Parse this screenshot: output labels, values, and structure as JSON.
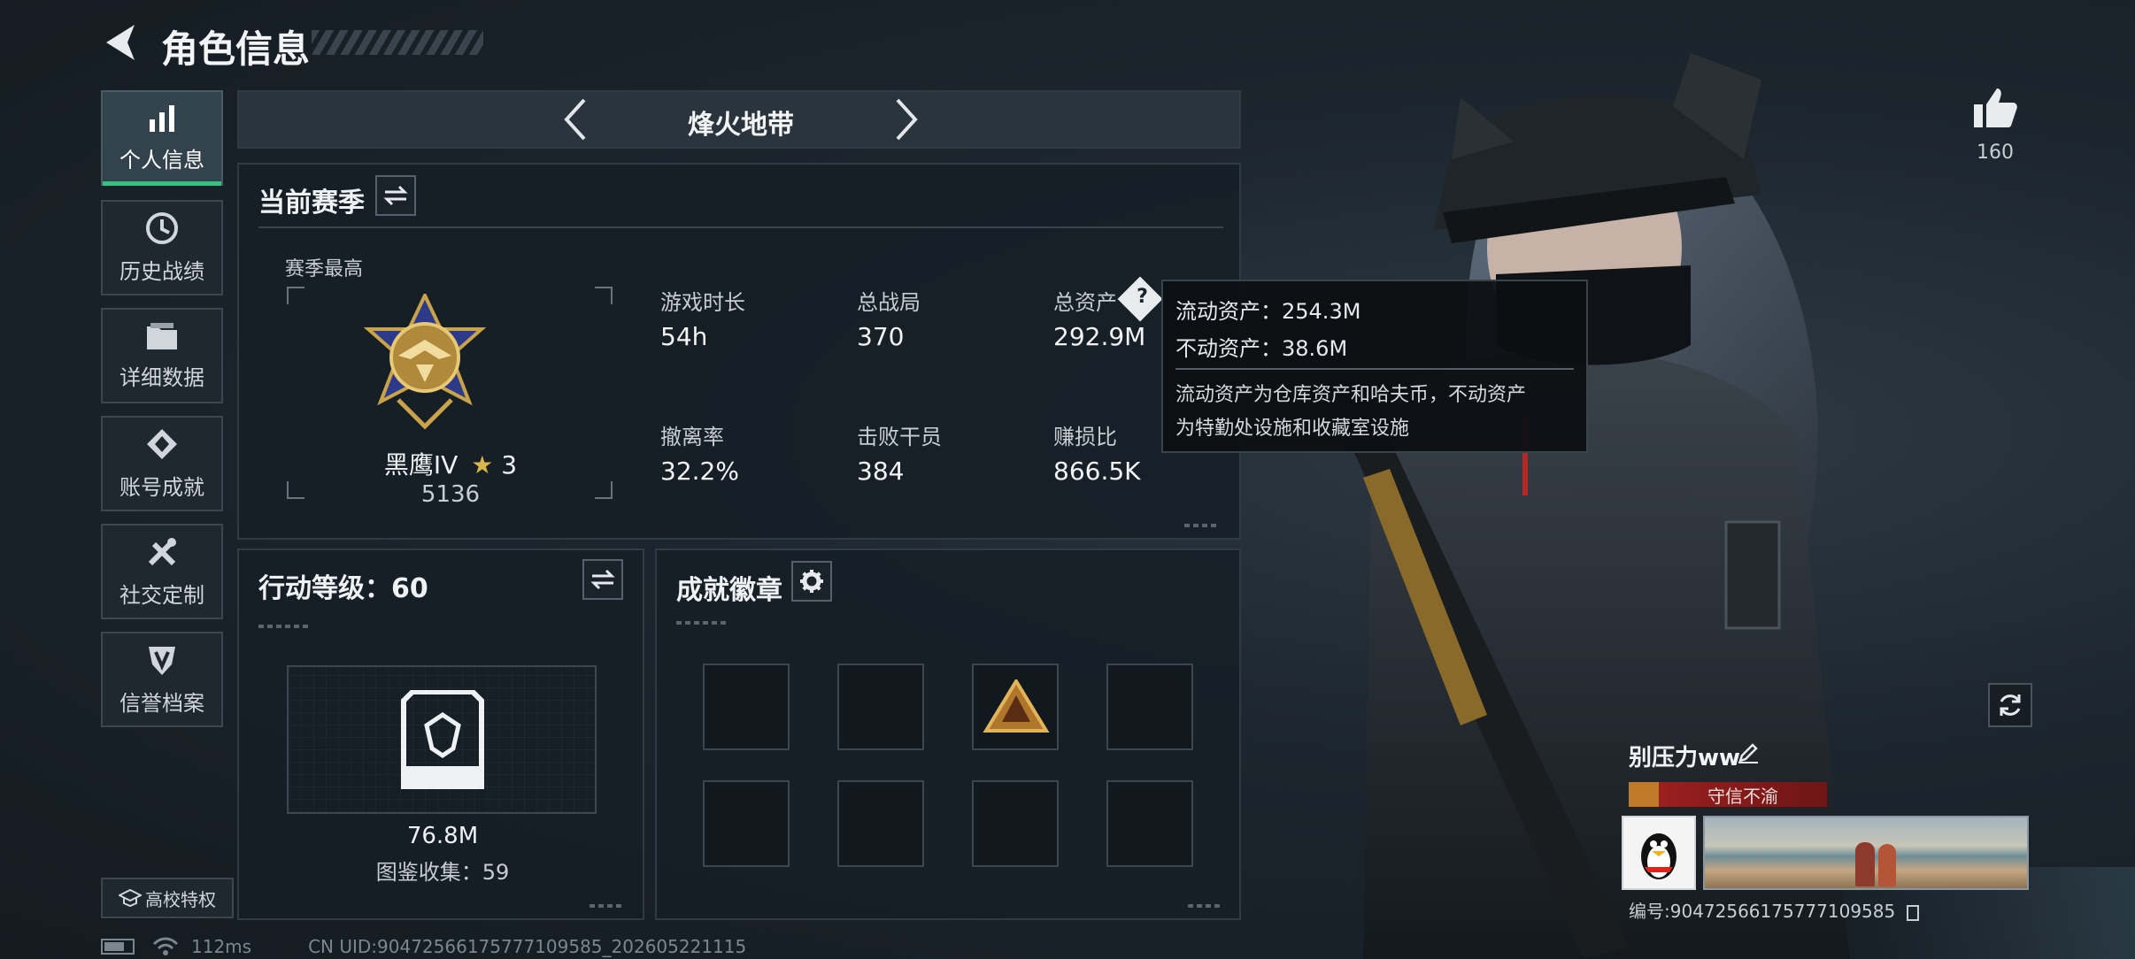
{
  "header": {
    "title": "角色信息"
  },
  "sidebar": {
    "items": [
      {
        "label": "个人信息",
        "icon": "bar-chart-icon",
        "active": true
      },
      {
        "label": "历史战绩",
        "icon": "history-icon"
      },
      {
        "label": "详细数据",
        "icon": "folder-icon"
      },
      {
        "label": "账号成就",
        "icon": "achievement-icon"
      },
      {
        "label": "社交定制",
        "icon": "tools-icon"
      },
      {
        "label": "信誉档案",
        "icon": "shield-icon"
      }
    ],
    "campus_label": "高校特权"
  },
  "mode_selector": {
    "label": "烽火地带"
  },
  "season": {
    "title": "当前赛季",
    "best_label": "赛季最高",
    "rank_name": "黑鹰IV",
    "rank_stars": "3",
    "rank_points": "5136",
    "stats": [
      {
        "label": "游戏时长",
        "value": "54h"
      },
      {
        "label": "总战局",
        "value": "370"
      },
      {
        "label": "总资产",
        "value": "292.9M"
      },
      {
        "label": "撤离率",
        "value": "32.2%"
      },
      {
        "label": "击败干员",
        "value": "384"
      },
      {
        "label": "赚损比",
        "value": "866.5K"
      }
    ]
  },
  "tooltip": {
    "liquid_label": "流动资产：",
    "liquid_value": "254.3M",
    "fixed_label": "不动资产：",
    "fixed_value": "38.6M",
    "desc_line1": "流动资产为仓库资产和哈夫币，不动资产",
    "desc_line2": "为特勤处设施和收藏室设施"
  },
  "action_level": {
    "title": "行动等级：60",
    "value": "76.8M",
    "collection": "图鉴收集：59"
  },
  "badges": {
    "title": "成就徽章"
  },
  "likes": {
    "count": "160"
  },
  "profile": {
    "name": "别压力ww",
    "reputation": "守信不渝",
    "id_text": "编号:9047256617577710958​5"
  },
  "status_bar": {
    "ping": "112ms",
    "uid": "CN UID:9047256617577710958​5_20260522111​5"
  },
  "colors": {
    "accent_green": "#35c17f",
    "gold_star": "#d9b64a",
    "reputation_red": "#8e1d1d"
  }
}
